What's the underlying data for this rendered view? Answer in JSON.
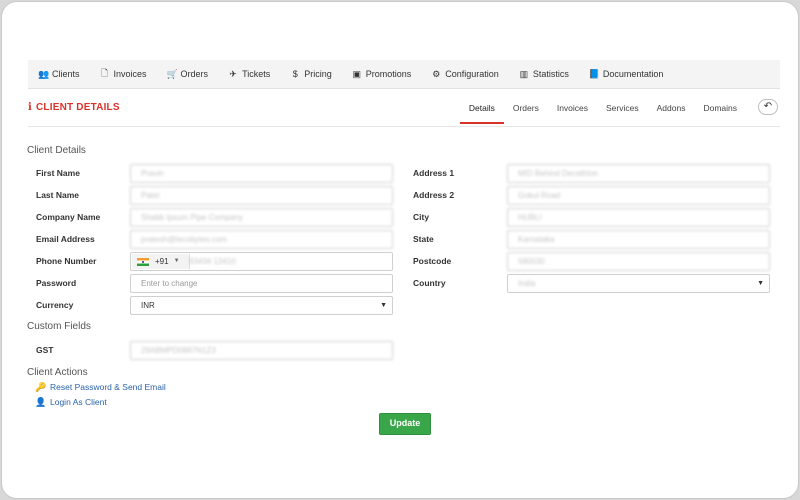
{
  "nav": {
    "items": [
      {
        "label": "Clients",
        "icon": "users-icon",
        "glyph": "👥"
      },
      {
        "label": "Invoices",
        "icon": "document-icon",
        "glyph": "🗋"
      },
      {
        "label": "Orders",
        "icon": "cart-icon",
        "glyph": "🛒"
      },
      {
        "label": "Tickets",
        "icon": "plane-icon",
        "glyph": "✈"
      },
      {
        "label": "Pricing",
        "icon": "dollar-icon",
        "glyph": "$"
      },
      {
        "label": "Promotions",
        "icon": "money-icon",
        "glyph": "▣"
      },
      {
        "label": "Configuration",
        "icon": "cogs-icon",
        "glyph": "⚙"
      },
      {
        "label": "Statistics",
        "icon": "bar-chart-icon",
        "glyph": "▥"
      },
      {
        "label": "Documentation",
        "icon": "book-icon",
        "glyph": "📘"
      }
    ]
  },
  "header": {
    "title": "CLIENT DETAILS",
    "info_glyph": "i",
    "tabs": [
      "Details",
      "Orders",
      "Invoices",
      "Services",
      "Addons",
      "Domains"
    ],
    "active_tab": "Details",
    "back_glyph": "↶"
  },
  "client_details": {
    "heading": "Client Details",
    "first_name": {
      "label": "First Name",
      "value": "Pravin"
    },
    "last_name": {
      "label": "Last Name",
      "value": "Patel"
    },
    "company": {
      "label": "Company Name",
      "value": "Shabb Ipsum Pipe Company"
    },
    "email": {
      "label": "Email Address",
      "value": "pratesh@lecobytes.com"
    },
    "phone": {
      "label": "Phone Number",
      "code": "+91",
      "value": "93434 13410"
    },
    "password": {
      "label": "Password",
      "placeholder": "Enter to change"
    },
    "currency": {
      "label": "Currency",
      "value": "INR"
    },
    "address1": {
      "label": "Address 1",
      "value": "MID Behind Decathlon"
    },
    "address2": {
      "label": "Address 2",
      "value": "Gokul Road"
    },
    "city": {
      "label": "City",
      "value": "HUBLI"
    },
    "state": {
      "label": "State",
      "value": "Karnataka"
    },
    "postcode": {
      "label": "Postcode",
      "value": "580030"
    },
    "country": {
      "label": "Country",
      "value": "India"
    }
  },
  "custom_fields": {
    "heading": "Custom Fields",
    "gst": {
      "label": "GST",
      "value": "29ABMPD0887N1Z3"
    }
  },
  "actions": {
    "heading": "Client Actions",
    "reset_password": "Reset Password & Send Email",
    "login_as_client": "Login As Client"
  },
  "update_label": "Update",
  "colors": {
    "accent": "#d9322b",
    "link": "#2a62a8",
    "button": "#3aa64a"
  }
}
